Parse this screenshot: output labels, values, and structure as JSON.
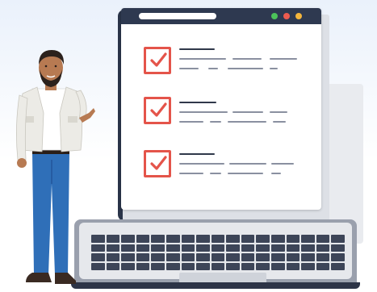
{
  "browser": {
    "dots": [
      {
        "name": "green",
        "color": "#4cc35a"
      },
      {
        "name": "red",
        "color": "#ee5b4f"
      },
      {
        "name": "yellow",
        "color": "#f4b63c"
      }
    ]
  },
  "tasks": [
    {
      "checked": true
    },
    {
      "checked": true
    },
    {
      "checked": true
    }
  ],
  "colors": {
    "accent_checkbox": "#e4544a",
    "screen_frame": "#2a3449",
    "shirt": "#ffffff",
    "vest": "#ecebe6",
    "jeans": "#2f6fb8",
    "skin": "#b77a52",
    "hair": "#2b211c"
  },
  "icons": [
    "checkmark-icon",
    "laptop-icon",
    "person-illustration"
  ]
}
